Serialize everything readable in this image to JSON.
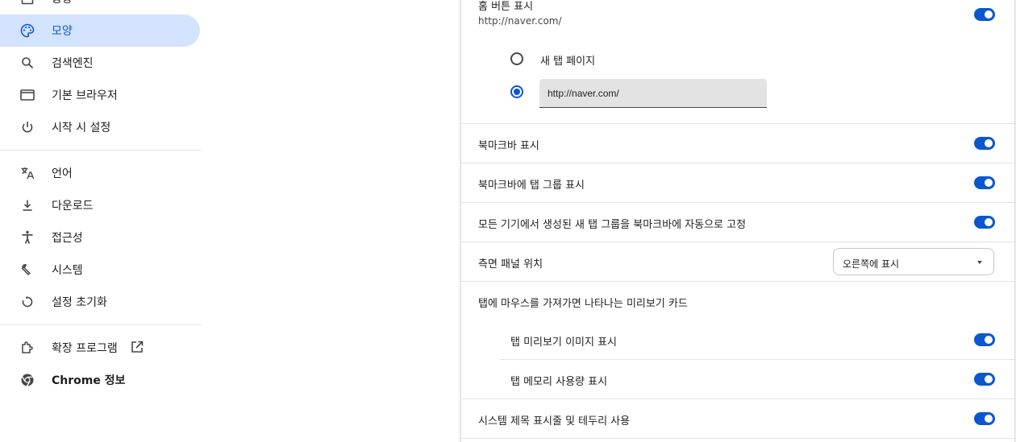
{
  "sidebar": {
    "items": [
      {
        "label": "농장",
        "icon": "home-icon"
      },
      {
        "label": "모양",
        "icon": "palette-icon",
        "active": true
      },
      {
        "label": "검색엔진",
        "icon": "search-icon"
      },
      {
        "label": "기본 브라우저",
        "icon": "browser-window-icon"
      },
      {
        "label": "시작 시 설정",
        "icon": "power-icon"
      },
      {
        "label": "언어",
        "icon": "translate-icon"
      },
      {
        "label": "다운로드",
        "icon": "download-icon"
      },
      {
        "label": "접근성",
        "icon": "accessibility-icon"
      },
      {
        "label": "시스템",
        "icon": "wrench-icon"
      },
      {
        "label": "설정 초기화",
        "icon": "reset-icon"
      },
      {
        "label": "확장 프로그램",
        "icon": "extension-icon"
      },
      {
        "label": "Chrome 정보",
        "icon": "chrome-icon"
      }
    ]
  },
  "settings": {
    "home_button": {
      "label": "홈 버튼 표시",
      "sublabel": "http://naver.com/",
      "enabled": true,
      "options": {
        "new_tab": "새 탭 페이지",
        "custom_url_value": "http://naver.com/",
        "selected": "custom_url"
      }
    },
    "show_bookmarks_bar": {
      "label": "북마크바 표시",
      "enabled": true
    },
    "show_tab_groups_in_bookmarks_bar": {
      "label": "북마크바에 탭 그룹 표시",
      "enabled": true
    },
    "auto_pin_tab_groups": {
      "label": "모든 기기에서 생성된 새 탭 그룹을 북마크바에 자동으로 고정",
      "enabled": true
    },
    "side_panel_position": {
      "label": "측면 패널 위치",
      "value": "오른쪽에 표시"
    },
    "hover_card": {
      "label": "탭에 마우스를 가져가면 나타나는 미리보기 카드",
      "image_preview": {
        "label": "탭 미리보기 이미지 표시",
        "enabled": true
      },
      "memory_usage": {
        "label": "탭 메모리 사용량 표시",
        "enabled": true
      }
    },
    "system_title_bar": {
      "label": "시스템 제목 표시줄 및 테두리 사용",
      "enabled": true
    }
  },
  "colors": {
    "accent": "#0b57d0",
    "active_nav_bg": "#d3e3fd",
    "divider": "#e3e3e3"
  }
}
